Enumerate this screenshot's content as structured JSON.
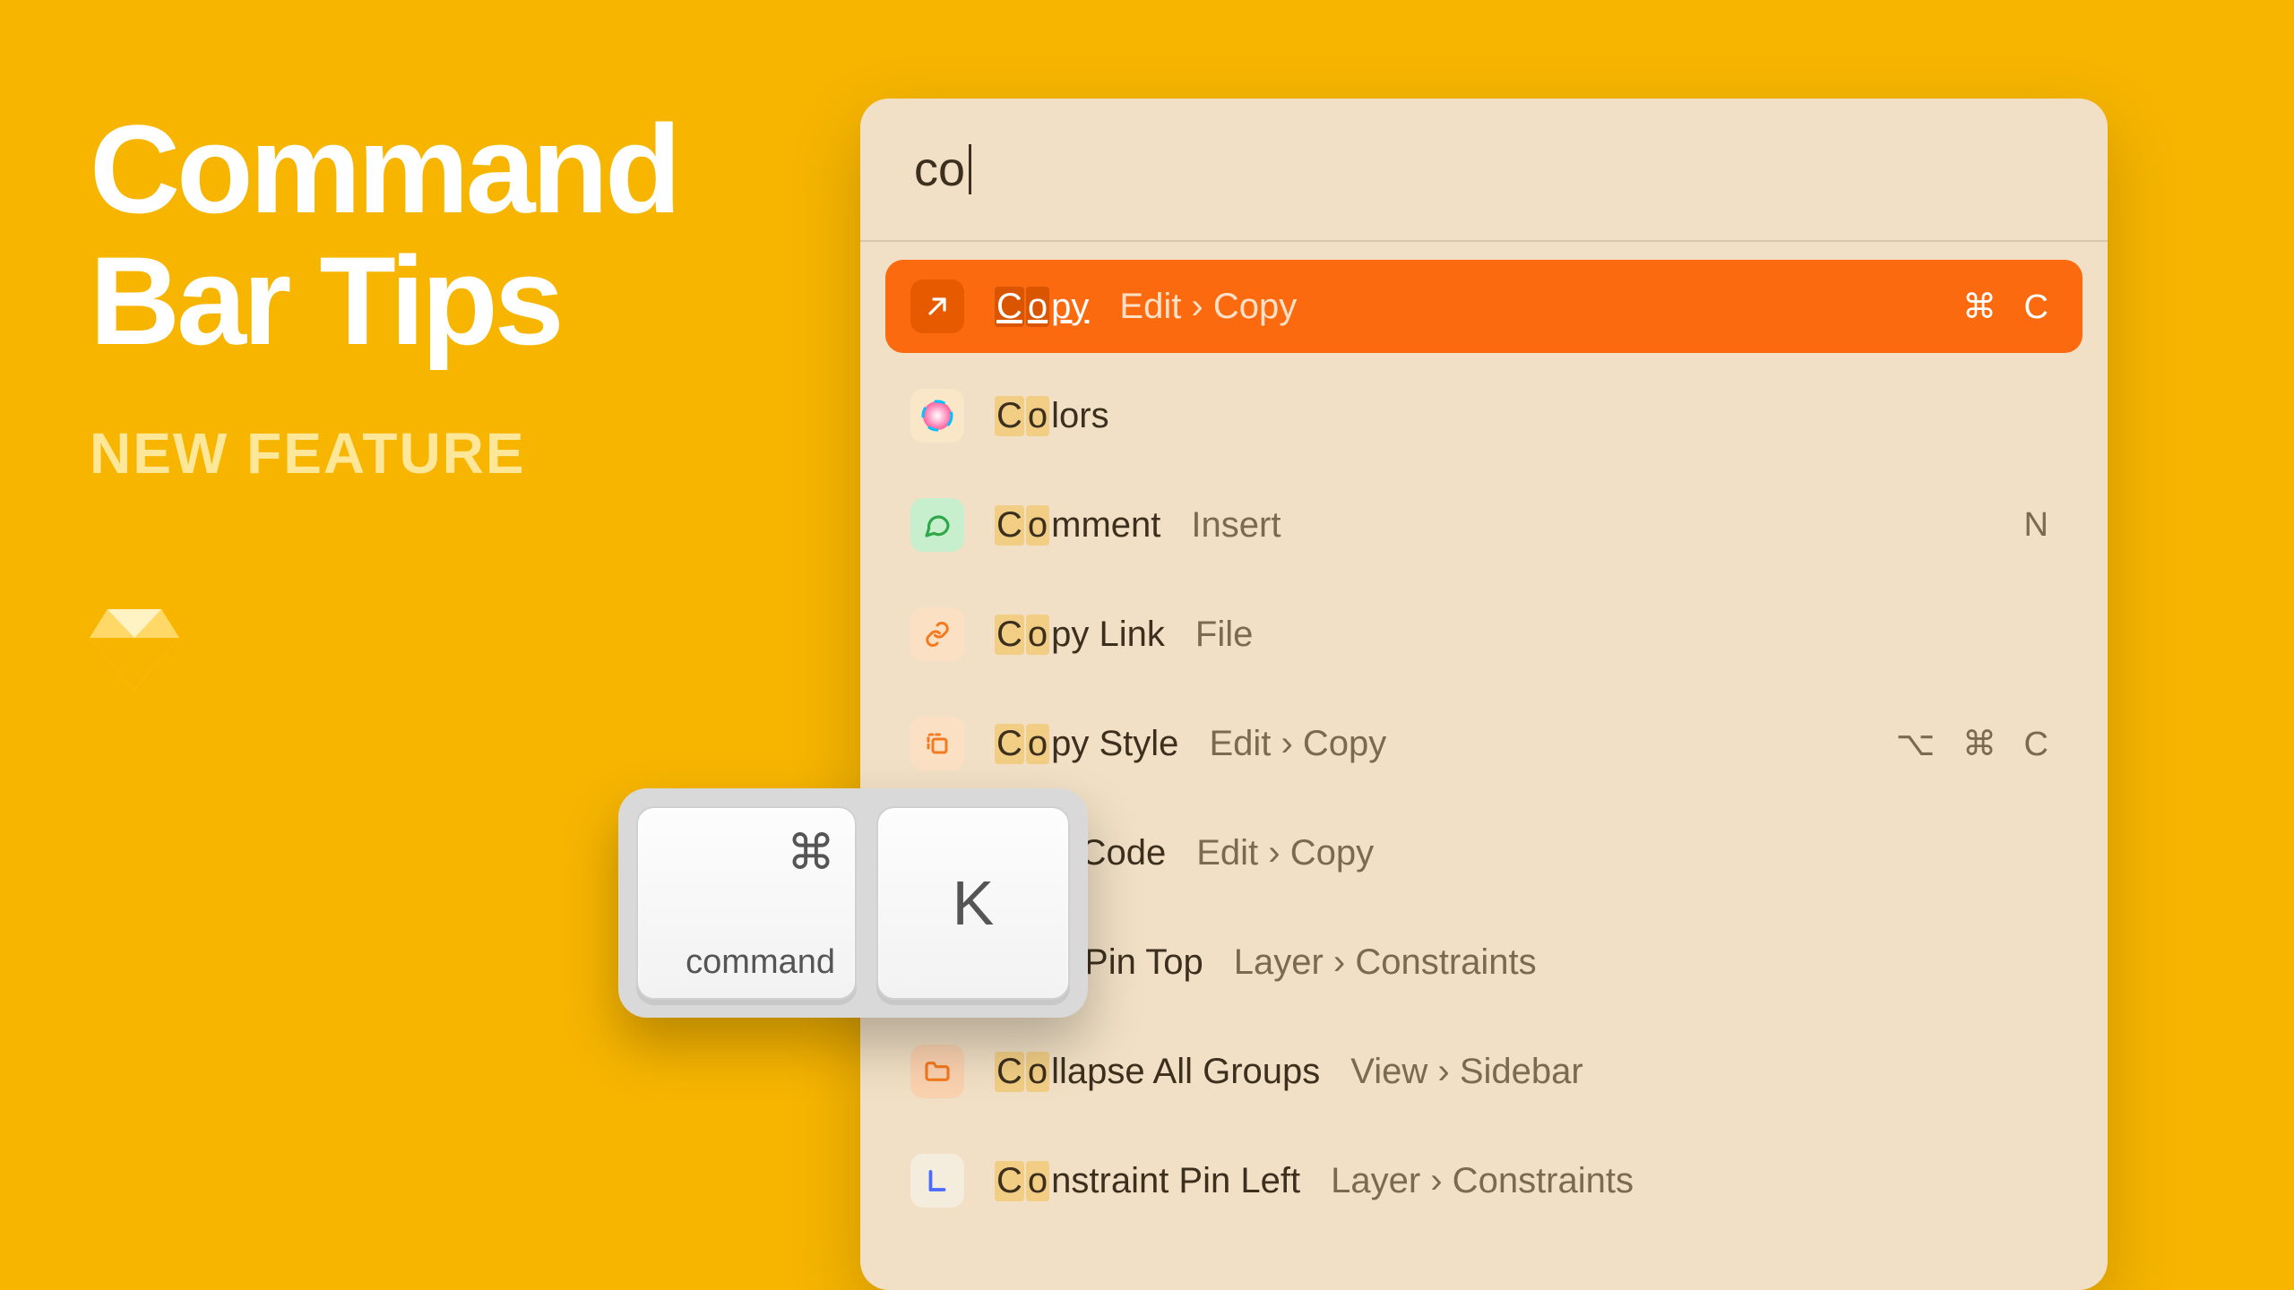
{
  "title_line1": "Command",
  "title_line2": "Bar Tips",
  "subtitle": "NEW FEATURE",
  "search_query": "co",
  "keys": {
    "cmd_glyph": "⌘",
    "cmd_label": "command",
    "k_label": "K"
  },
  "items": [
    {
      "icon": "arrow-up-right-icon",
      "icon_bg": "#E85A00",
      "icon_fg": "#FFFFFF",
      "highlight": "Co",
      "rest": "py",
      "path": "Edit › Copy",
      "shortcut": "⌘ C",
      "selected": true
    },
    {
      "icon": "color-wheel-icon",
      "icon_bg": "#F9E7C8",
      "icon_fg": "#FF4488",
      "highlight": "Co",
      "rest": "lors",
      "path": "",
      "shortcut": "",
      "selected": false
    },
    {
      "icon": "comment-icon",
      "icon_bg": "#C8EFCD",
      "icon_fg": "#2FA84A",
      "highlight": "Co",
      "rest": "mment",
      "path": "Insert",
      "shortcut": "N",
      "selected": false
    },
    {
      "icon": "link-icon",
      "icon_bg": "#FBE0C4",
      "icon_fg": "#F47A1F",
      "highlight": "Co",
      "rest": "py Link",
      "path": "File",
      "shortcut": "",
      "selected": false
    },
    {
      "icon": "style-box-icon",
      "icon_bg": "#FBE0C4",
      "icon_fg": "#F47A1F",
      "highlight": "Co",
      "rest": "py Style",
      "path": "Edit › Copy",
      "shortcut": "⌥ ⌘ C",
      "selected": false
    },
    {
      "icon": "svg-code-icon",
      "icon_bg": "transparent",
      "icon_fg": "#7A6A50",
      "highlight": "",
      "rest": "SVG Code",
      "path": "Edit › Copy",
      "shortcut": "",
      "selected": false,
      "truncated": true
    },
    {
      "icon": "pin-top-icon",
      "icon_bg": "transparent",
      "icon_fg": "#7A6A50",
      "highlight": "",
      "rest": "traint Pin Top",
      "path": "Layer › Constraints",
      "shortcut": "",
      "selected": false,
      "truncated": true
    },
    {
      "icon": "folder-icon",
      "icon_bg": "#FBD2B0",
      "icon_fg": "#F47A1F",
      "highlight": "Co",
      "rest": "llapse All Groups",
      "path": "View › Sidebar",
      "shortcut": "",
      "selected": false
    },
    {
      "icon": "pin-left-icon",
      "icon_bg": "#F4ECDC",
      "icon_fg": "#4A6AFF",
      "highlight": "Co",
      "rest": "nstraint Pin Left",
      "path": "Layer › Constraints",
      "shortcut": "",
      "selected": false
    }
  ]
}
